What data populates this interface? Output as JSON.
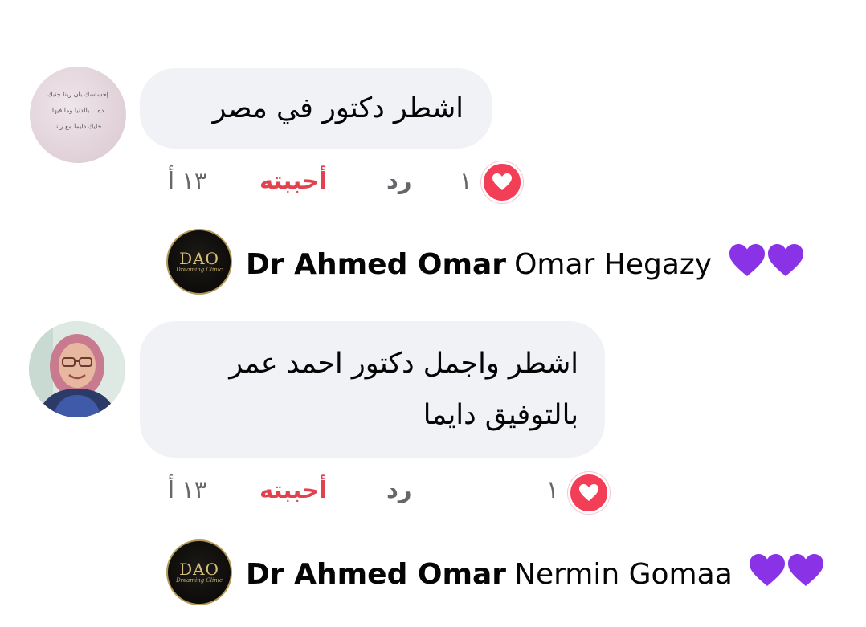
{
  "comments": [
    {
      "avatar_quote_lines": [
        "إحساسك بأن ربنا جنبك",
        "ده .. بالدنيا وما فيها",
        "خليك دايماً مع ربنا"
      ],
      "text_lines": [
        "اشطر دكتور في مصر"
      ],
      "reaction_count": "١",
      "reaction_icon": "heart-icon",
      "reply_label": "رد",
      "like_label": "أحببته",
      "time": "١٣ أ",
      "reply": {
        "author": "Dr Ahmed Omar",
        "mention": "Omar Hegazy",
        "emoji": "purple-heart-icon",
        "avatar_logo": "DAO",
        "avatar_logo_sub": "Dreaming Clinic"
      }
    },
    {
      "text_lines": [
        "اشطر واجمل دكتور احمد عمر",
        "بالتوفيق دايما"
      ],
      "reaction_count": "١",
      "reaction_icon": "heart-icon",
      "reply_label": "رد",
      "like_label": "أحببته",
      "time": "١٣ أ",
      "reply": {
        "author": "Dr Ahmed Omar",
        "mention": "Nermin Gomaa",
        "emoji": "purple-heart-icon",
        "avatar_logo": "DAO",
        "avatar_logo_sub": "Dreaming Clinic"
      }
    }
  ],
  "colors": {
    "bubble_bg": "#f0f2f5",
    "like_active": "#e0434f",
    "heart_react": "#f33e58",
    "purple_heart": "#8a33e6",
    "muted_text": "#65676b"
  }
}
